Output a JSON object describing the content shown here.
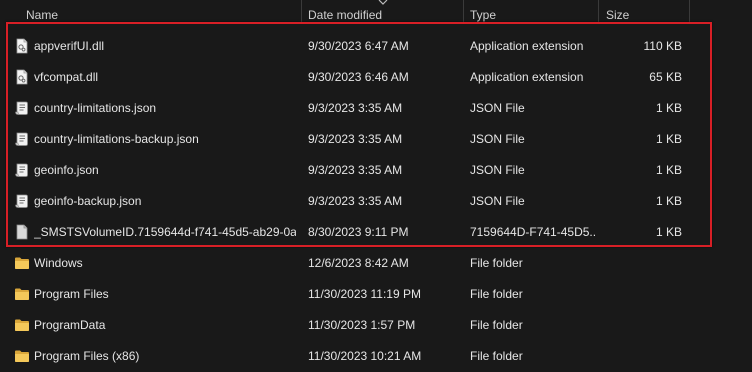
{
  "columns": {
    "name": "Name",
    "date": "Date modified",
    "type": "Type",
    "size": "Size"
  },
  "colors": {
    "highlight_border": "#d81f26",
    "background": "#191919",
    "folder": "#e8b84a"
  },
  "rows": [
    {
      "icon": "dll-file-icon",
      "name": "appverifUI.dll",
      "date": "9/30/2023 6:47 AM",
      "type": "Application extension",
      "size": "110 KB"
    },
    {
      "icon": "dll-file-icon",
      "name": "vfcompat.dll",
      "date": "9/30/2023 6:46 AM",
      "type": "Application extension",
      "size": "65 KB"
    },
    {
      "icon": "json-file-icon",
      "name": "country-limitations.json",
      "date": "9/3/2023 3:35 AM",
      "type": "JSON File",
      "size": "1 KB"
    },
    {
      "icon": "json-file-icon",
      "name": "country-limitations-backup.json",
      "date": "9/3/2023 3:35 AM",
      "type": "JSON File",
      "size": "1 KB"
    },
    {
      "icon": "json-file-icon",
      "name": "geoinfo.json",
      "date": "9/3/2023 3:35 AM",
      "type": "JSON File",
      "size": "1 KB"
    },
    {
      "icon": "json-file-icon",
      "name": "geoinfo-backup.json",
      "date": "9/3/2023 3:35 AM",
      "type": "JSON File",
      "size": "1 KB"
    },
    {
      "icon": "generic-file-icon",
      "name": "_SMSTSVolumeID.7159644d-f741-45d5-ab29-0a...",
      "date": "8/30/2023 9:11 PM",
      "type": "7159644D-F741-45D5...",
      "size": "1 KB"
    },
    {
      "icon": "folder-icon",
      "name": "Windows",
      "date": "12/6/2023 8:42 AM",
      "type": "File folder",
      "size": ""
    },
    {
      "icon": "folder-icon",
      "name": "Program Files",
      "date": "11/30/2023 11:19 PM",
      "type": "File folder",
      "size": ""
    },
    {
      "icon": "folder-icon",
      "name": "ProgramData",
      "date": "11/30/2023 1:57 PM",
      "type": "File folder",
      "size": ""
    },
    {
      "icon": "folder-icon",
      "name": "Program Files (x86)",
      "date": "11/30/2023 10:21 AM",
      "type": "File folder",
      "size": ""
    }
  ]
}
